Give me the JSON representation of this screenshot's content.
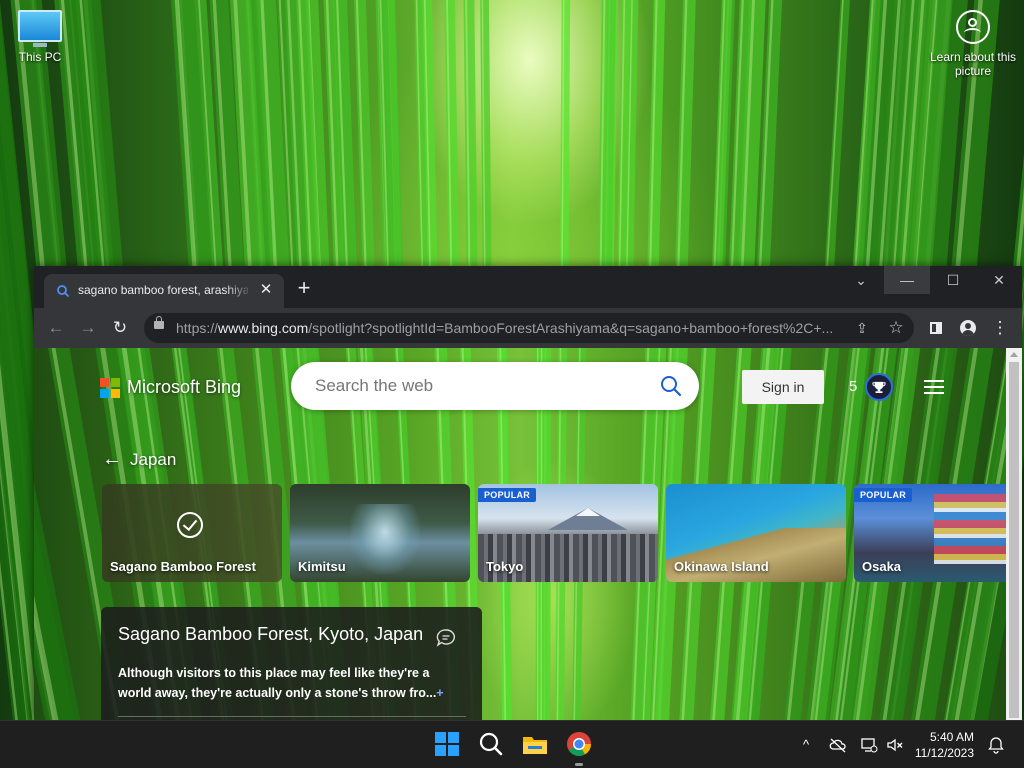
{
  "desktop": {
    "icons": [
      {
        "label": "This PC"
      },
      {
        "label": "Learn about this picture"
      }
    ]
  },
  "browser": {
    "tab": {
      "title": "sagano bamboo forest, arashiyama",
      "close": "✕"
    },
    "new_tab": "+",
    "tab_search": "⌄",
    "window_controls": {
      "minimize": "—",
      "maximize": "☐",
      "close": "✕"
    },
    "toolbar": {
      "back": "←",
      "forward": "→",
      "reload": "↻",
      "menu": "⋮",
      "bookmark": "☆",
      "share": "⇪"
    },
    "url": {
      "scheme": "https://",
      "domain": "www.bing.com",
      "path": "/spotlight?spotlightId=BambooForestArashiyama&q=sagano+bamboo+forest%2C+..."
    }
  },
  "bing": {
    "logo_text": "Microsoft Bing",
    "logo_colors": [
      "#f25022",
      "#7fba00",
      "#00a4ef",
      "#ffb900"
    ],
    "search_placeholder": "Search the web",
    "sign_in": "Sign in",
    "points": "5",
    "back_label": "Japan",
    "cards": [
      {
        "label": "Sagano Bamboo Forest",
        "badge": "",
        "selected": true
      },
      {
        "label": "Kimitsu",
        "badge": ""
      },
      {
        "label": "Tokyo",
        "badge": "POPULAR"
      },
      {
        "label": "Okinawa Island",
        "badge": ""
      },
      {
        "label": "Osaka",
        "badge": "POPULAR"
      }
    ],
    "info": {
      "title": "Sagano Bamboo Forest, Kyoto, Japan",
      "description": "Although visitors to this place may feel like they're a world away, they're actually only a stone's throw fro...",
      "more": "+"
    }
  },
  "taskbar": {
    "apps": [
      "start-icon",
      "search-icon",
      "file-explorer-icon",
      "chrome-icon"
    ],
    "tray": {
      "chevron": "^"
    },
    "time": "5:40 AM",
    "date": "11/12/2023"
  }
}
